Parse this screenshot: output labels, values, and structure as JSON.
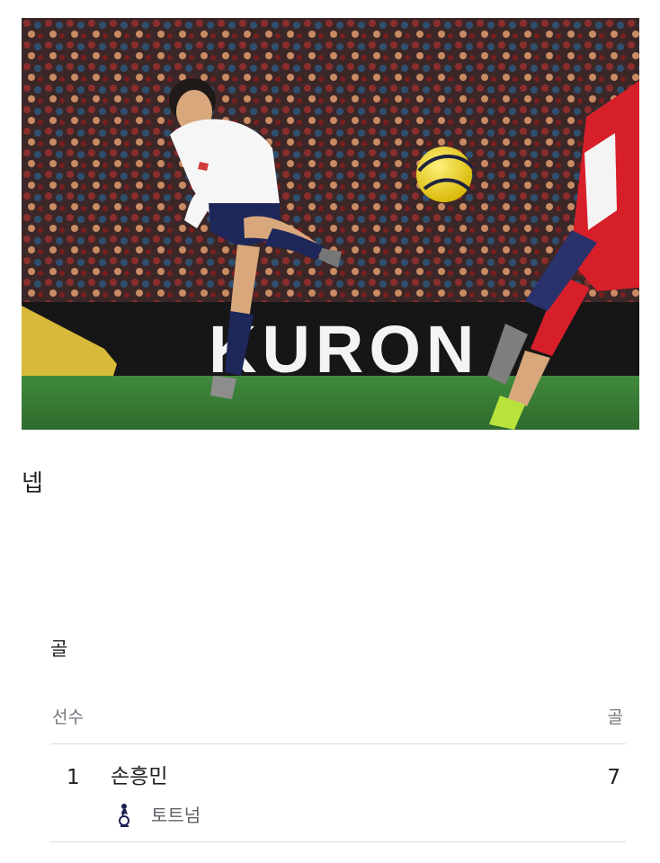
{
  "photo": {
    "board_text": "KURON"
  },
  "caption": "넵",
  "stats": {
    "title": "골",
    "columns": {
      "player": "선수",
      "goals": "골"
    },
    "rows": [
      {
        "rank": "1",
        "player": "손흥민",
        "team": "토트넘",
        "goals": "7"
      }
    ]
  }
}
